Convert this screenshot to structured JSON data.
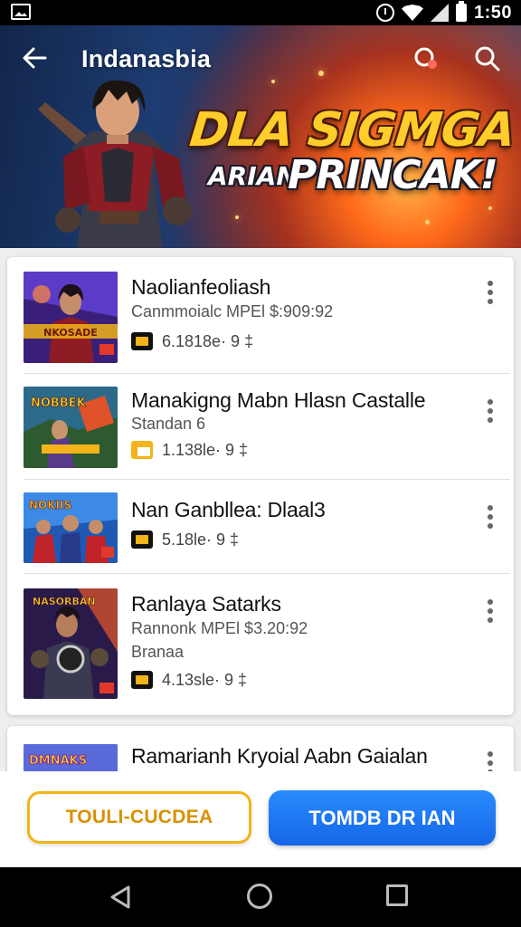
{
  "status_bar": {
    "time": "1:50"
  },
  "app_bar": {
    "title": "Indanasbia"
  },
  "banner": {
    "headline": "DLA SIGMGA",
    "subline_small": "ARIAN",
    "subline_big": "PRINCAK!"
  },
  "list": {
    "items": [
      {
        "title": "Naolianfeoliash",
        "subtitle": "Canmmoialc MPEl $:909:92",
        "meta_value": "6.1818e· 9 ‡",
        "icon": "ticket-icon",
        "thumb_text": "NKOSADE"
      },
      {
        "title": "Manakigng Mabn Hlasn Castalle",
        "subtitle": "Standan 6",
        "meta_value": "1.138le· 9 ‡",
        "icon": "ticket-icon",
        "thumb_text": "NOBBEK"
      },
      {
        "title": "Nan Ganbllea: Dlaal3",
        "subtitle": "",
        "meta_value": "5.18le· 9 ‡",
        "icon": "ticket-icon",
        "thumb_text": "NOKIIS"
      },
      {
        "title": "Ranlaya Satarks",
        "subtitle": "Rannonk MPEl $3.20:92",
        "subtitle2": "Branaa",
        "meta_value": "4.13sle· 9 ‡",
        "icon": "ticket-icon",
        "thumb_text": "NASORBAN"
      }
    ],
    "partial_item": {
      "title": "Ramarianh Kryoial Aabn Gaialan",
      "thumb_text": "DMNAKS"
    }
  },
  "actions": {
    "secondary_label": "TOULI-CUCDEA",
    "primary_label": "TOMDB DR IAN"
  },
  "colors": {
    "accent_yellow": "#f2b418",
    "primary_blue": "#1f7bf5",
    "banner_title": "#ffcd2a"
  }
}
